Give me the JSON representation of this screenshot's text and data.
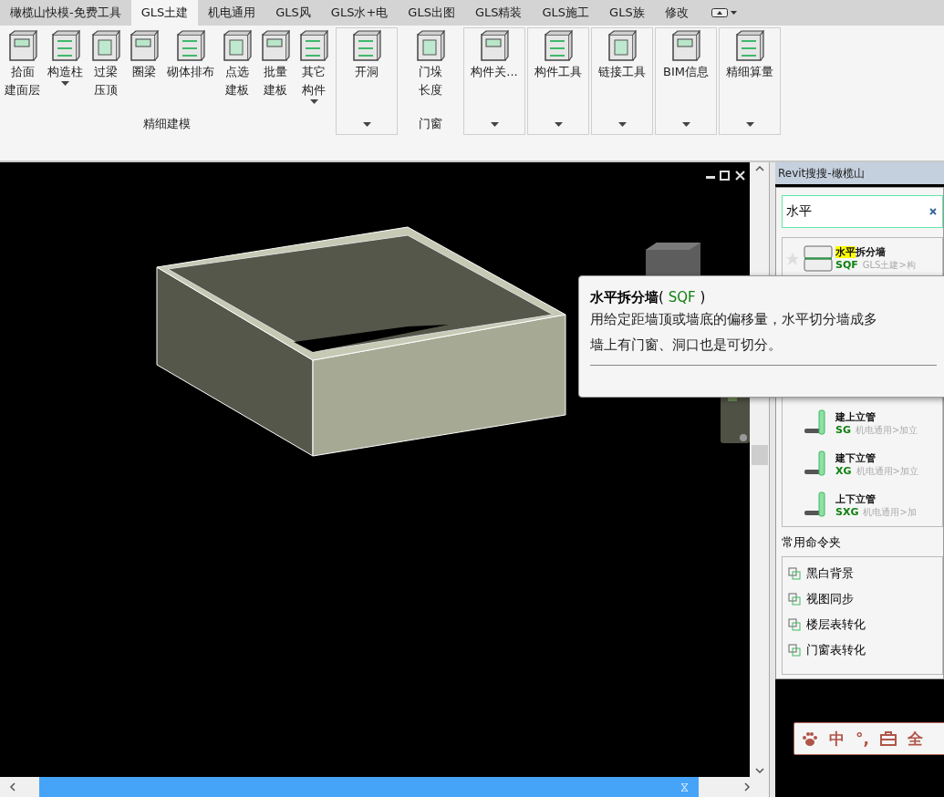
{
  "tabs": [
    {
      "label": "橄榄山快模-免费工具",
      "selected": false
    },
    {
      "label": "GLS土建",
      "selected": true
    },
    {
      "label": "机电通用",
      "selected": false
    },
    {
      "label": "GLS风",
      "selected": false
    },
    {
      "label": "GLS水+电",
      "selected": false
    },
    {
      "label": "GLS出图",
      "selected": false
    },
    {
      "label": "GLS精装",
      "selected": false
    },
    {
      "label": "GLS施工",
      "selected": false
    },
    {
      "label": "GLS族",
      "selected": false
    },
    {
      "label": "修改",
      "selected": false
    }
  ],
  "ribbon": {
    "groups": [
      {
        "label": "精细建模",
        "bordered": false,
        "tools": [
          {
            "lines": [
              "拾面",
              "建面层"
            ],
            "dropdown": false
          },
          {
            "lines": [
              "构造柱"
            ],
            "dropdown": true
          },
          {
            "lines": [
              "过梁",
              "压顶"
            ],
            "dropdown": false
          },
          {
            "lines": [
              "圈梁"
            ],
            "dropdown": false
          },
          {
            "lines": [
              "砌体排布"
            ],
            "dropdown": false
          },
          {
            "lines": [
              "点选",
              "建板"
            ],
            "dropdown": false
          },
          {
            "lines": [
              "批量",
              "建板"
            ],
            "dropdown": false
          },
          {
            "lines": [
              "其它",
              "构件"
            ],
            "dropdown": true
          }
        ]
      },
      {
        "bordered": true,
        "dropdown": true,
        "tools": [
          {
            "lines": [
              "开洞"
            ],
            "dropdown": false
          }
        ]
      },
      {
        "label": "门窗",
        "bordered": false,
        "tools": [
          {
            "lines": [
              "门垛",
              "长度"
            ],
            "dropdown": false
          }
        ]
      },
      {
        "bordered": true,
        "dropdown": true,
        "tools": [
          {
            "lines": [
              "构件关..."
            ],
            "dropdown": false
          }
        ]
      },
      {
        "bordered": true,
        "dropdown": true,
        "tools": [
          {
            "lines": [
              "构件工具"
            ],
            "dropdown": false
          }
        ]
      },
      {
        "bordered": true,
        "dropdown": true,
        "tools": [
          {
            "lines": [
              "链接工具"
            ],
            "dropdown": false
          }
        ]
      },
      {
        "bordered": true,
        "dropdown": true,
        "tools": [
          {
            "lines": [
              "BIM信息"
            ],
            "dropdown": false
          }
        ]
      },
      {
        "bordered": true,
        "dropdown": true,
        "tools": [
          {
            "lines": [
              "精细算量"
            ],
            "dropdown": false
          }
        ]
      }
    ]
  },
  "panel": {
    "title": "Revit搜搜-橄榄山",
    "search": {
      "value": "水平"
    },
    "results": [
      {
        "match": "水平",
        "rest": "拆分墙",
        "code": "SQF",
        "path": "GLS土建>构"
      },
      {
        "rest": "建上立管",
        "code": "SG",
        "path": "机电通用>加立"
      },
      {
        "rest": "建下立管",
        "code": "XG",
        "path": "机电通用>加立"
      },
      {
        "rest": "上下立管",
        "code": "SXG",
        "path": "机电通用>加"
      }
    ],
    "commands_label": "常用命令夹",
    "commands": [
      "黑白背景",
      "视图同步",
      "楼层表转化",
      "门窗表转化"
    ]
  },
  "tooltip": {
    "title": "水平拆分墙",
    "open": "(",
    "code": "SQF",
    "close": ")",
    "lines": [
      "用给定距墙顶或墙底的偏移量，水平切分墙成多",
      "墙上有门窗、洞口也是可切分。"
    ]
  },
  "ime": {
    "items": [
      {
        "kind": "icon"
      },
      {
        "kind": "text",
        "text": "中"
      },
      {
        "kind": "text",
        "text": "°,"
      },
      {
        "kind": "icon"
      },
      {
        "kind": "text",
        "text": "全"
      }
    ]
  }
}
